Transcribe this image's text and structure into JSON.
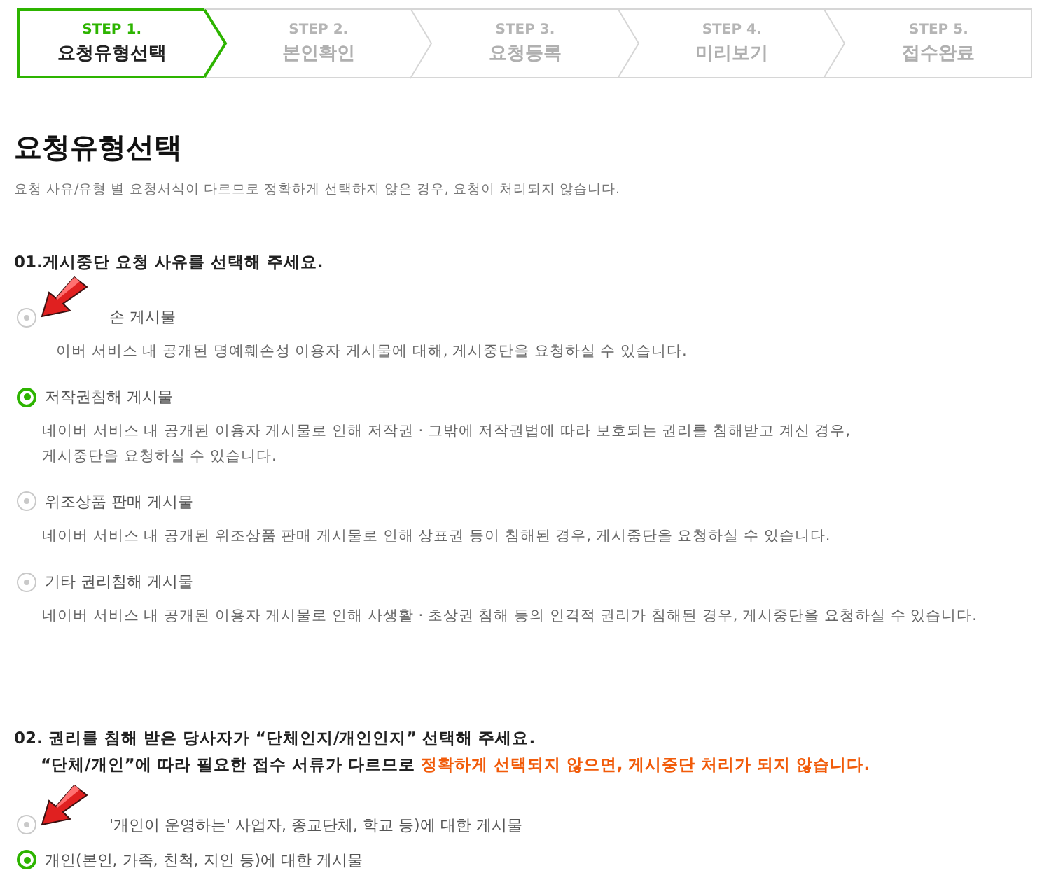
{
  "steps": [
    {
      "number": "STEP 1.",
      "label": "요청유형선택",
      "selected": true
    },
    {
      "number": "STEP 2.",
      "label": "본인확인",
      "selected": false
    },
    {
      "number": "STEP 3.",
      "label": "요청등록",
      "selected": false
    },
    {
      "number": "STEP 4.",
      "label": "미리보기",
      "selected": false
    },
    {
      "number": "STEP 5.",
      "label": "접수완료",
      "selected": false
    }
  ],
  "title": "요청유형선택",
  "subtitle": "요청 사유/유형 별 요청서식이 다르므로 정확하게 선택하지 않은 경우, 요청이 처리되지 않습니다.",
  "sections": [
    {
      "heading": "01.게시중단 요청 사유를 선택해 주세요.",
      "options": [
        {
          "label": "손 게시물",
          "description": "이버 서비스 내 공개된 명예훼손성 이용자 게시물에 대해, 게시중단을 요청하실 수 있습니다.",
          "selected": false,
          "arrow": true
        },
        {
          "label": "저작권침해 게시물",
          "description": "네이버 서비스 내 공개된 이용자 게시물로 인해 저작권 · 그밖에 저작권법에 따라 보호되는 권리를 침해받고 계신 경우,\n게시중단을 요청하실 수 있습니다.",
          "selected": true,
          "arrow": false
        },
        {
          "label": "위조상품 판매 게시물",
          "description": "네이버 서비스 내 공개된 위조상품 판매 게시물로 인해 상표권 등이 침해된 경우, 게시중단을 요청하실 수 있습니다.",
          "selected": false,
          "arrow": false
        },
        {
          "label": "기타 권리침해 게시물",
          "description": "네이버 서비스 내 공개된 이용자 게시물로 인해 사생활 · 초상권 침해 등의 인격적 권리가 침해된 경우, 게시중단을 요청하실 수 있습니다.",
          "selected": false,
          "arrow": false
        }
      ]
    },
    {
      "heading": "02. 권리를 침해 받은 당사자가 “단체인지/개인인지” 선택해 주세요.",
      "note": "“단체/개인”에 따라 필요한 접수 서류가 다르므로",
      "warning": "정확하게 선택되지 않으면, 게시중단 처리가 되지 않습니다.",
      "options": [
        {
          "label": "'개인이 운영하는' 사업자, 종교단체, 학교 등)에 대한 게시물",
          "selected": false,
          "arrow": true
        },
        {
          "label": "개인(본인, 가족, 친척, 지인 등)에 대한 게시물",
          "selected": true,
          "arrow": false
        }
      ]
    }
  ]
}
